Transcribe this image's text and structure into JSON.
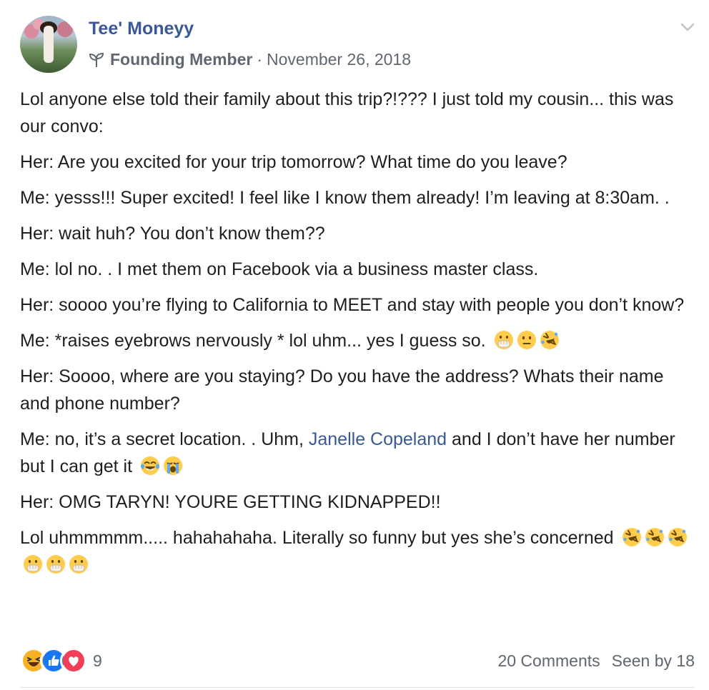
{
  "post": {
    "author": "Tee' Moneyy",
    "badge_icon": "sprout-icon",
    "badge": "Founding Member",
    "separator": "·",
    "date": "November 26, 2018",
    "menu_icon": "chevron-down-icon",
    "paragraphs": {
      "p1": "Lol anyone else told their family about this trip?!??? I just told my cousin... this was our convo:",
      "p2": "Her: Are you excited for your trip tomorrow? What time do you leave?",
      "p3": "Me: yesss!!! Super excited! I feel like I know them already! I’m leaving at 8:30am. .",
      "p4": "Her: wait huh? You don’t know them??",
      "p5": "Me: lol no. . I met them on Facebook via a business master class.",
      "p6": "Her: soooo you’re flying to California to MEET and stay with people you don’t know?",
      "p7": "Me: *raises eyebrows nervously * lol uhm... yes I guess so.",
      "p8": "Her: Soooo, where are you staying? Do you have the address? Whats their name and phone number?",
      "p9_before": "Me: no, it’s a secret location. . Uhm, ",
      "p9_mention": "Janelle Copeland",
      "p9_after": " and I don’t have her number but I can get it",
      "p10": "Her: OMG TARYN! YOURE GETTING KIDNAPPED!!",
      "p11": "Lol uhmmmmm..... hahahahaha. Literally so funny but yes she’s concerned"
    },
    "emojis": {
      "p7": [
        "hand-over-mouth-emoji",
        "neutral-face-emoji",
        "rolling-laughing-emoji"
      ],
      "p9": [
        "tears-of-joy-emoji",
        "crying-face-emoji"
      ],
      "p11": [
        "rolling-laughing-emoji",
        "rolling-laughing-emoji",
        "rolling-laughing-emoji",
        "hand-over-mouth-emoji",
        "hand-over-mouth-emoji",
        "hand-over-mouth-emoji"
      ]
    },
    "reactions": {
      "types": [
        "haha",
        "like",
        "love"
      ],
      "count": "9"
    },
    "comments": "20 Comments",
    "seen": "Seen by 18"
  },
  "colors": {
    "link": "#385898",
    "text": "#1c1e21",
    "secondary": "#606770",
    "like": "#1877f2",
    "love": "#f33e58",
    "haha": "#f7b125"
  }
}
